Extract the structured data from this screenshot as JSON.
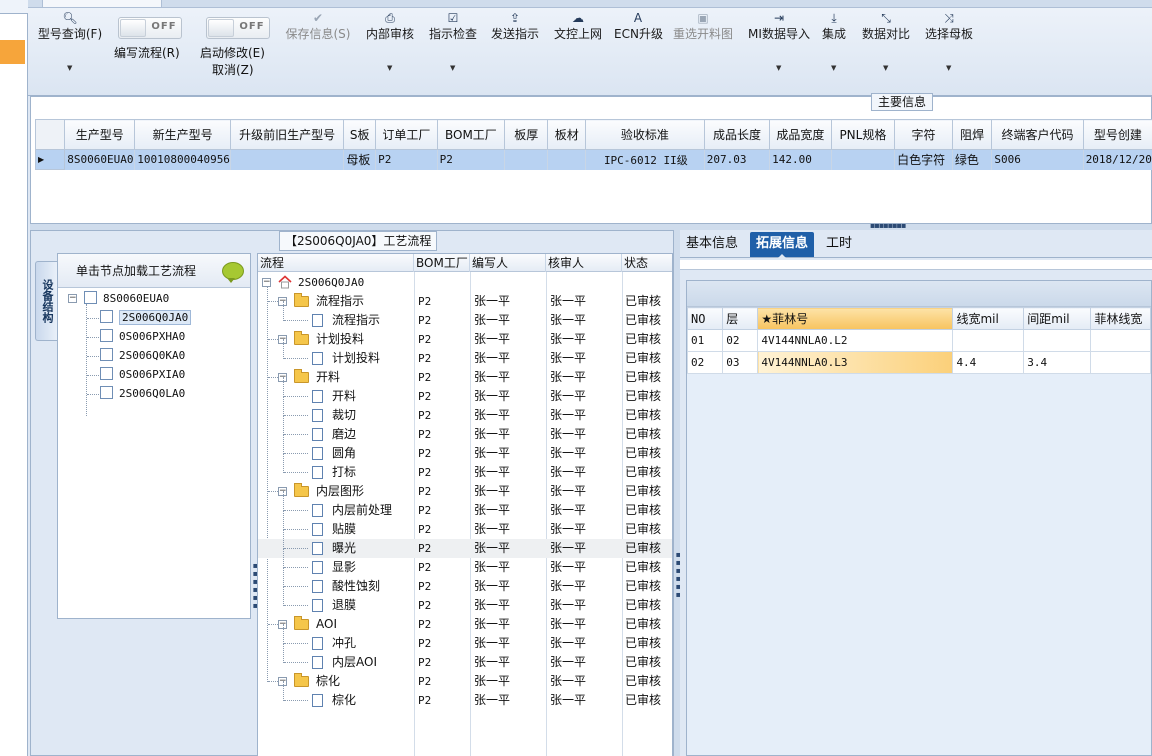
{
  "ribbon": {
    "buttons": [
      {
        "label": "型号查询(F)",
        "icon": "search-icon",
        "has_menu": true,
        "enabled": true
      },
      {
        "label": "编写流程(R)",
        "icon": "toggle",
        "toggle": "OFF",
        "enabled": true
      },
      {
        "label": "启动修改(E)",
        "sublabel": "取消(Z)",
        "icon": "toggle",
        "toggle": "OFF",
        "enabled": true
      },
      {
        "label": "保存信息(S)",
        "icon": "check-icon",
        "enabled": false
      },
      {
        "label": "内部审核",
        "icon": "print-icon",
        "has_menu": true,
        "enabled": true
      },
      {
        "label": "指示检查",
        "icon": "checkbox-icon",
        "has_menu": true,
        "enabled": true
      },
      {
        "label": "发送指示",
        "icon": "upload-icon",
        "enabled": true
      },
      {
        "label": "文控上网",
        "icon": "cloud-upload-icon",
        "enabled": true
      },
      {
        "label": "ECN升级",
        "icon": "font-icon",
        "enabled": true
      },
      {
        "label": "重选开料图",
        "icon": "image-icon",
        "enabled": false
      },
      {
        "label": "MI数据导入",
        "icon": "sign-in-icon",
        "has_menu": true,
        "enabled": true
      },
      {
        "label": "集成",
        "icon": "download-icon",
        "has_menu": true,
        "enabled": true
      },
      {
        "label": "数据对比",
        "icon": "compress-icon",
        "has_menu": true,
        "enabled": true
      },
      {
        "label": "选择母板",
        "icon": "random-icon",
        "has_menu": true,
        "enabled": true
      }
    ]
  },
  "main_info": {
    "caption": "主要信息",
    "columns": [
      "生产型号",
      "新生产型号",
      "升级前旧生产型号",
      "S板",
      "订单工厂",
      "BOM工厂",
      "板厚",
      "板材",
      "验收标准",
      "成品长度",
      "成品宽度",
      "PNL规格",
      "字符",
      "阻焊",
      "终端客户代码",
      "型号创建"
    ],
    "rows": [
      [
        "8S0060EUA0",
        "10010800040956",
        "",
        "母板",
        "P2",
        "P2",
        "",
        "",
        "IPC-6012 II级",
        "207.03",
        "142.00",
        "",
        "白色字符",
        "绿色",
        "S006",
        "2018/12/20"
      ]
    ]
  },
  "flow_panel": {
    "title": "【2S006Q0JA0】工艺流程",
    "vertical_tab": "设备结构",
    "struct_header": "单击节点加载工艺流程",
    "struct_tree": {
      "root": "8S0060EUA0",
      "children": [
        "2S006Q0JA0",
        "0S006PXHA0",
        "2S006Q0KA0",
        "0S006PXIA0",
        "2S006Q0LA0"
      ],
      "selected": "2S006Q0JA0"
    },
    "flow_columns": [
      "流程",
      "BOM工厂",
      "编写人",
      "核审人",
      "状态"
    ],
    "flow_root": "2S006Q0JA0",
    "flow_rows": [
      {
        "name": "流程指示",
        "level": 1,
        "type": "folder",
        "bom": "P2",
        "writer": "张一平",
        "reviewer": "张一平",
        "status": "已审核"
      },
      {
        "name": "流程指示",
        "level": 2,
        "type": "doc",
        "bom": "P2",
        "writer": "张一平",
        "reviewer": "张一平",
        "status": "已审核"
      },
      {
        "name": "计划投料",
        "level": 1,
        "type": "folder",
        "bom": "P2",
        "writer": "张一平",
        "reviewer": "张一平",
        "status": "已审核"
      },
      {
        "name": "计划投料",
        "level": 2,
        "type": "doc",
        "bom": "P2",
        "writer": "张一平",
        "reviewer": "张一平",
        "status": "已审核"
      },
      {
        "name": "开料",
        "level": 1,
        "type": "folder",
        "bom": "P2",
        "writer": "张一平",
        "reviewer": "张一平",
        "status": "已审核"
      },
      {
        "name": "开料",
        "level": 2,
        "type": "doc",
        "bom": "P2",
        "writer": "张一平",
        "reviewer": "张一平",
        "status": "已审核"
      },
      {
        "name": "裁切",
        "level": 2,
        "type": "doc",
        "bom": "P2",
        "writer": "张一平",
        "reviewer": "张一平",
        "status": "已审核"
      },
      {
        "name": "磨边",
        "level": 2,
        "type": "doc",
        "bom": "P2",
        "writer": "张一平",
        "reviewer": "张一平",
        "status": "已审核"
      },
      {
        "name": "圆角",
        "level": 2,
        "type": "doc",
        "bom": "P2",
        "writer": "张一平",
        "reviewer": "张一平",
        "status": "已审核"
      },
      {
        "name": "打标",
        "level": 2,
        "type": "doc",
        "bom": "P2",
        "writer": "张一平",
        "reviewer": "张一平",
        "status": "已审核"
      },
      {
        "name": "内层图形",
        "level": 1,
        "type": "folder",
        "bom": "P2",
        "writer": "张一平",
        "reviewer": "张一平",
        "status": "已审核"
      },
      {
        "name": "内层前处理",
        "level": 2,
        "type": "doc",
        "bom": "P2",
        "writer": "张一平",
        "reviewer": "张一平",
        "status": "已审核"
      },
      {
        "name": "贴膜",
        "level": 2,
        "type": "doc",
        "bom": "P2",
        "writer": "张一平",
        "reviewer": "张一平",
        "status": "已审核"
      },
      {
        "name": "曝光",
        "level": 2,
        "type": "doc",
        "bom": "P2",
        "writer": "张一平",
        "reviewer": "张一平",
        "status": "已审核",
        "highlight": true
      },
      {
        "name": "显影",
        "level": 2,
        "type": "doc",
        "bom": "P2",
        "writer": "张一平",
        "reviewer": "张一平",
        "status": "已审核"
      },
      {
        "name": "酸性蚀刻",
        "level": 2,
        "type": "doc",
        "bom": "P2",
        "writer": "张一平",
        "reviewer": "张一平",
        "status": "已审核"
      },
      {
        "name": "退膜",
        "level": 2,
        "type": "doc",
        "bom": "P2",
        "writer": "张一平",
        "reviewer": "张一平",
        "status": "已审核"
      },
      {
        "name": "AOI",
        "level": 1,
        "type": "folder",
        "bom": "P2",
        "writer": "张一平",
        "reviewer": "张一平",
        "status": "已审核"
      },
      {
        "name": "冲孔",
        "level": 2,
        "type": "doc",
        "bom": "P2",
        "writer": "张一平",
        "reviewer": "张一平",
        "status": "已审核"
      },
      {
        "name": "内层AOI",
        "level": 2,
        "type": "doc",
        "bom": "P2",
        "writer": "张一平",
        "reviewer": "张一平",
        "status": "已审核"
      },
      {
        "name": "棕化",
        "level": 1,
        "type": "folder",
        "bom": "P2",
        "writer": "张一平",
        "reviewer": "张一平",
        "status": "已审核"
      },
      {
        "name": "棕化",
        "level": 2,
        "type": "doc",
        "bom": "P2",
        "writer": "张一平",
        "reviewer": "张一平",
        "status": "已审核"
      }
    ]
  },
  "right_panel": {
    "tabs": [
      "基本信息",
      "拓展信息",
      "工时"
    ],
    "active_tab": "拓展信息",
    "columns": [
      "NO",
      "层",
      "★菲林号",
      "线宽mil",
      "间距mil",
      "菲林线宽"
    ],
    "rows": [
      [
        "01",
        "02",
        "4V144NNLA0.L2",
        "",
        "",
        ""
      ],
      [
        "02",
        "03",
        "4V144NNLA0.L3",
        "4.4",
        "3.4",
        ""
      ]
    ]
  },
  "colors": {
    "accent": "#1f5fa8",
    "selection": "#b8d2f2",
    "highlight_orange": "#f7c35f"
  }
}
